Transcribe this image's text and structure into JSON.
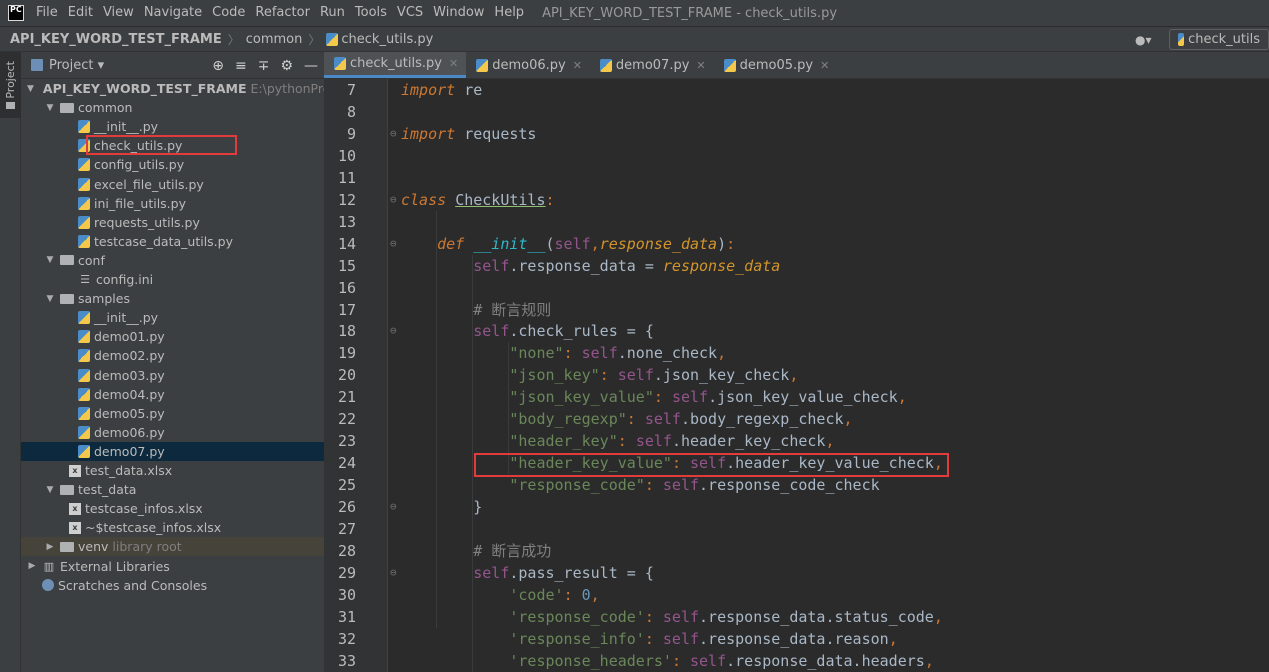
{
  "menu": {
    "items": [
      "File",
      "Edit",
      "View",
      "Navigate",
      "Code",
      "Refactor",
      "Run",
      "Tools",
      "VCS",
      "Window",
      "Help"
    ],
    "window_title": "API_KEY_WORD_TEST_FRAME - check_utils.py",
    "logo_text": "PC"
  },
  "nav": {
    "root": "API_KEY_WORD_TEST_FRAME",
    "folder": "common",
    "file": "check_utils.py",
    "run_config": "check_utils"
  },
  "stripe": {
    "project_label": "Project"
  },
  "project": {
    "title": "Project",
    "tree": [
      {
        "label": "API_KEY_WORD_TEST_FRAME",
        "hint": "E:\\pythonProjec",
        "type": "folder",
        "depth": 0,
        "expanded": true,
        "bold": true
      },
      {
        "label": "common",
        "type": "pkg",
        "depth": 1,
        "expanded": true
      },
      {
        "label": "__init__.py",
        "type": "py",
        "depth": 2
      },
      {
        "label": "check_utils.py",
        "type": "py",
        "depth": 2,
        "boxed": true
      },
      {
        "label": "config_utils.py",
        "type": "py",
        "depth": 2
      },
      {
        "label": "excel_file_utils.py",
        "type": "py",
        "depth": 2
      },
      {
        "label": "ini_file_utils.py",
        "type": "py",
        "depth": 2
      },
      {
        "label": "requests_utils.py",
        "type": "py",
        "depth": 2
      },
      {
        "label": "testcase_data_utils.py",
        "type": "py",
        "depth": 2
      },
      {
        "label": "conf",
        "type": "folder",
        "depth": 1,
        "expanded": true
      },
      {
        "label": "config.ini",
        "type": "ini",
        "depth": 2
      },
      {
        "label": "samples",
        "type": "pkg",
        "depth": 1,
        "expanded": true
      },
      {
        "label": "__init__.py",
        "type": "py",
        "depth": 2
      },
      {
        "label": "demo01.py",
        "type": "py",
        "depth": 2
      },
      {
        "label": "demo02.py",
        "type": "py",
        "depth": 2
      },
      {
        "label": "demo03.py",
        "type": "py",
        "depth": 2
      },
      {
        "label": "demo04.py",
        "type": "py",
        "depth": 2
      },
      {
        "label": "demo05.py",
        "type": "py",
        "depth": 2
      },
      {
        "label": "demo06.py",
        "type": "py",
        "depth": 2
      },
      {
        "label": "demo07.py",
        "type": "py",
        "depth": 2,
        "selected": true
      },
      {
        "label": "test_data.xlsx",
        "type": "xls",
        "depth": 1.5
      },
      {
        "label": "test_data",
        "type": "folder",
        "depth": 1,
        "expanded": true
      },
      {
        "label": "testcase_infos.xlsx",
        "type": "xls",
        "depth": 1.5
      },
      {
        "label": "~$testcase_infos.xlsx",
        "type": "xls",
        "depth": 1.5
      },
      {
        "label": "venv",
        "hint": "library root",
        "type": "folder",
        "depth": 1,
        "expanded": false,
        "venv": true
      },
      {
        "label": "External Libraries",
        "type": "lib",
        "depth": 0,
        "expanded": false
      },
      {
        "label": "Scratches and Consoles",
        "type": "scratch",
        "depth": 0
      }
    ]
  },
  "tabs": [
    {
      "label": "check_utils.py",
      "active": true
    },
    {
      "label": "demo06.py"
    },
    {
      "label": "demo07.py"
    },
    {
      "label": "demo05.py"
    }
  ],
  "editor": {
    "lines": [
      {
        "n": "7",
        "tokens": [
          [
            "kwi",
            "import"
          ],
          [
            "",
            " re"
          ]
        ]
      },
      {
        "n": "8",
        "tokens": []
      },
      {
        "n": "9",
        "fold": "⊖",
        "tokens": [
          [
            "kwi",
            "import"
          ],
          [
            "",
            " requests"
          ]
        ]
      },
      {
        "n": "10",
        "tokens": []
      },
      {
        "n": "11",
        "tokens": []
      },
      {
        "n": "12",
        "fold": "⊖",
        "tokens": [
          [
            "kwi",
            "class"
          ],
          [
            "",
            " "
          ],
          [
            "cls",
            "CheckUtils"
          ],
          [
            "kw",
            ":"
          ]
        ]
      },
      {
        "n": "13",
        "tokens": []
      },
      {
        "n": "14",
        "fold": "⊖",
        "tokens": [
          [
            "",
            "    "
          ],
          [
            "kwi",
            "def"
          ],
          [
            "",
            " "
          ],
          [
            "magic",
            "__init__"
          ],
          [
            "",
            "("
          ],
          [
            "self",
            "self"
          ],
          [
            "kw",
            ","
          ],
          [
            "param",
            "response_data"
          ],
          [
            "",
            ")"
          ],
          [
            "kw",
            ":"
          ]
        ]
      },
      {
        "n": "15",
        "tokens": [
          [
            "",
            "        "
          ],
          [
            "self",
            "self"
          ],
          [
            "",
            ".response_data = "
          ],
          [
            "param",
            "response_data"
          ]
        ]
      },
      {
        "n": "16",
        "tokens": []
      },
      {
        "n": "17",
        "tokens": [
          [
            "",
            "        "
          ],
          [
            "cmt",
            "# 断言规则"
          ]
        ]
      },
      {
        "n": "18",
        "fold": "⊖",
        "tokens": [
          [
            "",
            "        "
          ],
          [
            "self",
            "self"
          ],
          [
            "",
            ".check_rules = {"
          ]
        ]
      },
      {
        "n": "19",
        "tokens": [
          [
            "",
            "            "
          ],
          [
            "str",
            "\"none\""
          ],
          [
            "kw",
            ": "
          ],
          [
            "self",
            "self"
          ],
          [
            "",
            ".none_check"
          ],
          [
            "kw",
            ","
          ]
        ]
      },
      {
        "n": "20",
        "tokens": [
          [
            "",
            "            "
          ],
          [
            "str",
            "\"json_key\""
          ],
          [
            "kw",
            ": "
          ],
          [
            "self",
            "self"
          ],
          [
            "",
            ".json_key_check"
          ],
          [
            "kw",
            ","
          ]
        ]
      },
      {
        "n": "21",
        "tokens": [
          [
            "",
            "            "
          ],
          [
            "str",
            "\"json_key_value\""
          ],
          [
            "kw",
            ": "
          ],
          [
            "self",
            "self"
          ],
          [
            "",
            ".json_key_value_check"
          ],
          [
            "kw",
            ","
          ]
        ]
      },
      {
        "n": "22",
        "tokens": [
          [
            "",
            "            "
          ],
          [
            "str",
            "\"body_regexp\""
          ],
          [
            "kw",
            ": "
          ],
          [
            "self",
            "self"
          ],
          [
            "",
            ".body_regexp_check"
          ],
          [
            "kw",
            ","
          ]
        ]
      },
      {
        "n": "23",
        "tokens": [
          [
            "",
            "            "
          ],
          [
            "str",
            "\"header_key\""
          ],
          [
            "kw",
            ": "
          ],
          [
            "self",
            "self"
          ],
          [
            "",
            ".header_key_check"
          ],
          [
            "kw",
            ","
          ]
        ]
      },
      {
        "n": "24",
        "boxed": true,
        "tokens": [
          [
            "",
            "            "
          ],
          [
            "str",
            "\"header_key_value\""
          ],
          [
            "kw",
            ": "
          ],
          [
            "self",
            "self"
          ],
          [
            "",
            ".header_key_value_check"
          ],
          [
            "kw",
            ","
          ]
        ]
      },
      {
        "n": "25",
        "tokens": [
          [
            "",
            "            "
          ],
          [
            "str",
            "\"response_code\""
          ],
          [
            "kw",
            ": "
          ],
          [
            "self",
            "self"
          ],
          [
            "",
            ".response_code_check"
          ]
        ]
      },
      {
        "n": "26",
        "fold": "⊖",
        "tokens": [
          [
            "",
            "        }"
          ]
        ]
      },
      {
        "n": "27",
        "tokens": []
      },
      {
        "n": "28",
        "tokens": [
          [
            "",
            "        "
          ],
          [
            "cmt",
            "# 断言成功"
          ]
        ]
      },
      {
        "n": "29",
        "fold": "⊖",
        "tokens": [
          [
            "",
            "        "
          ],
          [
            "self",
            "self"
          ],
          [
            "",
            ".pass_result = {"
          ]
        ]
      },
      {
        "n": "30",
        "tokens": [
          [
            "",
            "            "
          ],
          [
            "str",
            "'code'"
          ],
          [
            "kw",
            ": "
          ],
          [
            "num",
            "0"
          ],
          [
            "kw",
            ","
          ]
        ]
      },
      {
        "n": "31",
        "tokens": [
          [
            "",
            "            "
          ],
          [
            "str",
            "'response_code'"
          ],
          [
            "kw",
            ": "
          ],
          [
            "self",
            "self"
          ],
          [
            "",
            ".response_data.status_code"
          ],
          [
            "kw",
            ","
          ]
        ]
      },
      {
        "n": "32",
        "tokens": [
          [
            "",
            "            "
          ],
          [
            "str",
            "'response_info'"
          ],
          [
            "kw",
            ": "
          ],
          [
            "self",
            "self"
          ],
          [
            "",
            ".response_data.reason"
          ],
          [
            "kw",
            ","
          ]
        ]
      },
      {
        "n": "33",
        "tokens": [
          [
            "",
            "            "
          ],
          [
            "str",
            "'response_headers'"
          ],
          [
            "kw",
            ": "
          ],
          [
            "self",
            "self"
          ],
          [
            "",
            ".response_data.headers"
          ],
          [
            "kw",
            ","
          ]
        ]
      }
    ]
  }
}
